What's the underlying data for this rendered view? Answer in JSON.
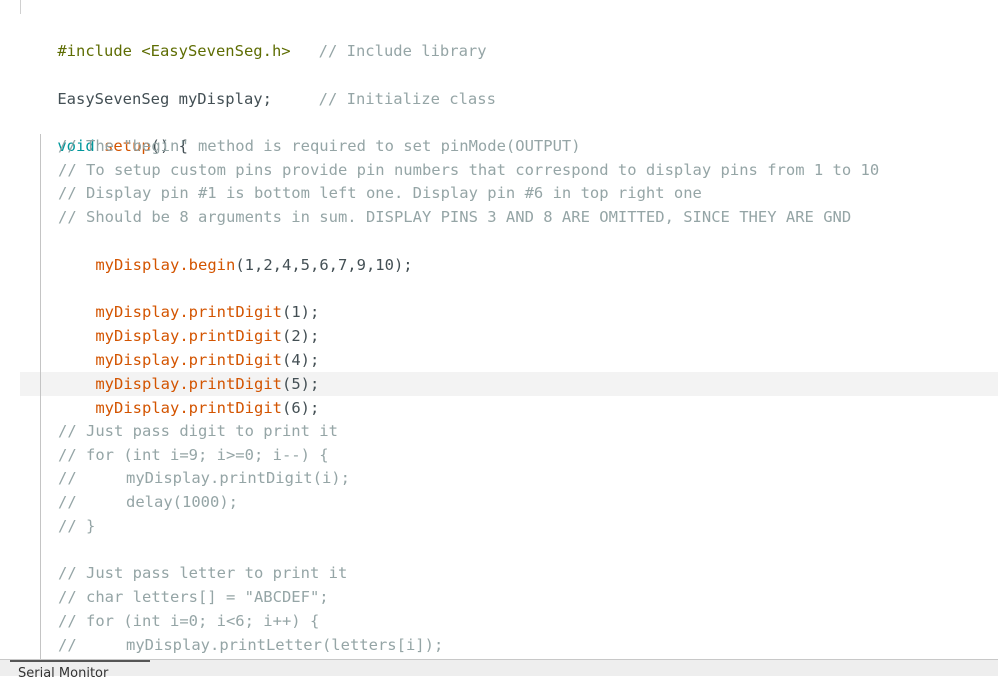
{
  "editor": {
    "lines": [
      {
        "k": "pp",
        "a": "#include",
        "b": " <EasySevenSeg.h>",
        "c": "   // Include library"
      },
      {
        "k": "decl",
        "a": "EasySevenSeg myDisplay;",
        "c": "     // Initialize class"
      },
      {
        "k": "setup",
        "a": "void",
        "b": " setup",
        "p": "() {"
      },
      {
        "k": "cm",
        "c": "// The \"begin\" method is required to set pinMode(OUTPUT)"
      },
      {
        "k": "cm",
        "c": "// To setup custom pins provide pin numbers that correspond to display pins from 1 to 10"
      },
      {
        "k": "cm",
        "c": "// Display pin #1 is bottom left one. Display pin #6 in top right one"
      },
      {
        "k": "cm",
        "c": "// Should be 8 arguments in sum. DISPLAY PINS 3 AND 8 ARE OMITTED, SINCE THEY ARE GND"
      },
      {
        "k": "call",
        "a": "myDisplay",
        "f": ".begin",
        "p": "(1,2,4,5,6,7,9,10);"
      },
      {
        "k": "call",
        "a": "myDisplay",
        "f": ".printDigit",
        "p": "(1);"
      },
      {
        "k": "call",
        "a": "myDisplay",
        "f": ".printDigit",
        "p": "(2);"
      },
      {
        "k": "call",
        "a": "myDisplay",
        "f": ".printDigit",
        "p": "(4);"
      },
      {
        "k": "call",
        "a": "myDisplay",
        "f": ".printDigit",
        "p": "(5);"
      },
      {
        "k": "call",
        "a": "myDisplay",
        "f": ".printDigit",
        "p": "(6);"
      },
      {
        "k": "cm",
        "c": "// Just pass digit to print it"
      },
      {
        "k": "cm",
        "c": "// for (int i=9; i>=0; i--) {"
      },
      {
        "k": "cm2",
        "c": "//",
        "d": "myDisplay.printDigit(i);"
      },
      {
        "k": "cm2",
        "c": "//",
        "d": "delay(1000);"
      },
      {
        "k": "cm",
        "c": "// }"
      },
      {
        "k": "cm",
        "c": "// Just pass letter to print it"
      },
      {
        "k": "cm",
        "c": "// char letters[] = \"ABCDEF\";"
      },
      {
        "k": "cm",
        "c": "// for (int i=0; i<6; i++) {"
      },
      {
        "k": "cm2",
        "c": "//",
        "d": "myDisplay.printLetter(letters[i]);"
      }
    ]
  },
  "footer": {
    "panel_label": "Serial Monitor"
  }
}
